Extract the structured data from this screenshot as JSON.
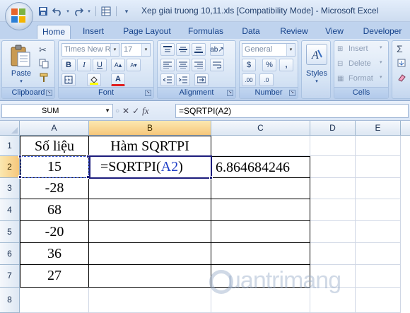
{
  "window": {
    "title": "Xep giai truong 10,11.xls  [Compatibility Mode] - Microsoft Excel"
  },
  "qat": {
    "icons": [
      "save-icon",
      "undo-icon",
      "redo-icon",
      "form-icon",
      "customize-icon"
    ]
  },
  "ribbon": {
    "tabs": [
      "Home",
      "Insert",
      "Page Layout",
      "Formulas",
      "Data",
      "Review",
      "View",
      "Developer"
    ],
    "active_tab": "Home",
    "clipboard": {
      "label": "Clipboard",
      "paste": "Paste"
    },
    "font": {
      "label": "Font",
      "font_name": "Times New Ro",
      "font_size": "17",
      "bold": "B",
      "italic": "I",
      "underline": "U",
      "font_color_letter": "A"
    },
    "alignment": {
      "label": "Alignment"
    },
    "number": {
      "label": "Number",
      "format": "General",
      "currency": "$",
      "percent": "%",
      "comma": ",",
      "inc_decimal": ".00",
      "dec_decimal": ".0"
    },
    "styles": {
      "label": "Styles"
    },
    "cells": {
      "label": "Cells",
      "insert": "Insert",
      "delete": "Delete",
      "format": "Format"
    },
    "editing_partial": {
      "sigma": "Σ"
    }
  },
  "formula_bar": {
    "name_box": "SUM",
    "fx": "fx",
    "formula": "=SQRTPI(A2)"
  },
  "sheet": {
    "columns": [
      "A",
      "B",
      "C",
      "D",
      "E"
    ],
    "rows": [
      "1",
      "2",
      "3",
      "4",
      "5",
      "6",
      "7",
      "8"
    ],
    "cells": {
      "A1": "Số liệu",
      "B1": "Hàm SQRTPI",
      "A2": "15",
      "B2_prefix": "=SQRTPI(",
      "B2_ref": "A2",
      "B2_suffix": ")",
      "C2": "6.864684246",
      "A3": "-28",
      "A4": "68",
      "A5": "-20",
      "A6": "36",
      "A7": "27"
    }
  },
  "colors": {
    "ribbon_bg": "#c7daf1",
    "selected_header": "#f6c77b",
    "reference_blue": "#1f3fc7",
    "active_border": "#1c1c7c"
  },
  "watermark": "uantrimang"
}
